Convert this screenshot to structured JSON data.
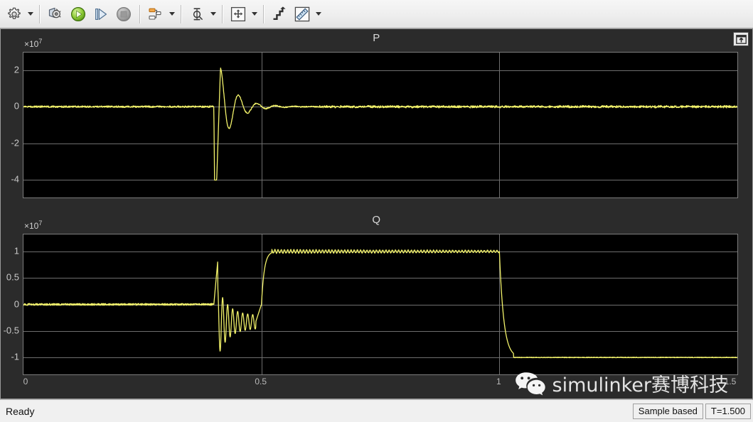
{
  "toolbar": {
    "groups": [
      {
        "name": "config",
        "buttons": [
          {
            "icon": "gear-icon",
            "label": "Configuration Properties",
            "caret": true
          }
        ]
      },
      {
        "name": "simulation",
        "buttons": [
          {
            "icon": "run-back-to-model-icon",
            "label": "View Simulink Model",
            "caret": false
          },
          {
            "icon": "run-play-icon",
            "label": "Run",
            "caret": false
          },
          {
            "icon": "step-forward-icon",
            "label": "Step Forward",
            "caret": false
          },
          {
            "icon": "stop-icon",
            "label": "Stop",
            "caret": false
          }
        ]
      },
      {
        "name": "layout",
        "buttons": [
          {
            "icon": "signal-selector-icon",
            "label": "Signal Selector",
            "caret": true
          }
        ]
      },
      {
        "name": "cursor",
        "buttons": [
          {
            "icon": "cursor-measurements-icon",
            "label": "Cursor Measurements",
            "caret": true
          }
        ]
      },
      {
        "name": "zoom",
        "buttons": [
          {
            "icon": "pan-icon",
            "label": "Pan",
            "caret": true
          }
        ]
      },
      {
        "name": "scale",
        "buttons": [
          {
            "icon": "autoscale-icon",
            "label": "Scale Y-Axis Limits",
            "caret": false
          },
          {
            "icon": "measurements-icon",
            "label": "Measurements",
            "caret": true
          }
        ]
      }
    ]
  },
  "scope": {
    "undock_icon": "undock-float-icon",
    "watermark": {
      "icon": "wechat-logo-icon",
      "text": "simulinker赛博科技"
    }
  },
  "chart_data": [
    {
      "type": "line",
      "id": "plot-p",
      "title": "P",
      "y_multiplier": "×10",
      "y_multiplier_exp": "7",
      "xlabel": "",
      "ylabel": "",
      "xlim": [
        0,
        1.5
      ],
      "ylim": [
        -4.95,
        2.95
      ],
      "xticks": [],
      "xticklabels": [],
      "yticks": [
        2,
        0,
        -2,
        -4
      ],
      "yticklabels": [
        "2",
        "0",
        "-2",
        "-4"
      ],
      "grid": true,
      "grid_v": [
        0.5,
        1.0
      ],
      "line_color": "#f2f26a",
      "bg_color": "#000000",
      "series": [
        {
          "name": "P",
          "note": "Near-zero noisy signal; at t=0.40 a large negative spike to -4.0e7 then a positive overshoot to 2.15e7, followed by damped ringing decaying back to ~0 by t=0.62; flat noisy zero through t=1.5",
          "steady_value": 0,
          "event_time": 0.4,
          "min_value": -4.0,
          "max_value": 2.15
        }
      ]
    },
    {
      "type": "line",
      "id": "plot-q",
      "title": "Q",
      "y_multiplier": "×10",
      "y_multiplier_exp": "7",
      "xlabel": "",
      "ylabel": "",
      "xlim": [
        0,
        1.5
      ],
      "ylim": [
        -1.32,
        1.32
      ],
      "xticks": [
        0,
        0.5,
        1,
        1.5
      ],
      "xticklabels": [
        "0",
        "0.5",
        "1",
        "1.5"
      ],
      "yticks": [
        1,
        0.5,
        0,
        -0.5,
        -1
      ],
      "yticklabels": [
        "1",
        "0.5",
        "0",
        "-0.5",
        "-1"
      ],
      "grid": true,
      "grid_v": [
        0.5,
        1.0
      ],
      "line_color": "#f2f26a",
      "bg_color": "#000000",
      "series": [
        {
          "name": "Q",
          "note": "Zero until t=0.40; spike to 0.8e7 then oscillation around -0.35e7 until t=0.50; step up to 1.0e7 with small ripple held until t=1.0; sharp drop to -1.0e7 held flat to t=1.5",
          "steady_value": 0,
          "event_times": [
            0.4,
            0.5,
            1.0
          ],
          "min_value": -1.0,
          "max_value": 1.0,
          "plateau_high": 1.0,
          "plateau_low": -1.0
        }
      ]
    }
  ],
  "status": {
    "message": "Ready",
    "frame_mode": "Sample based",
    "time": "T=1.500"
  }
}
